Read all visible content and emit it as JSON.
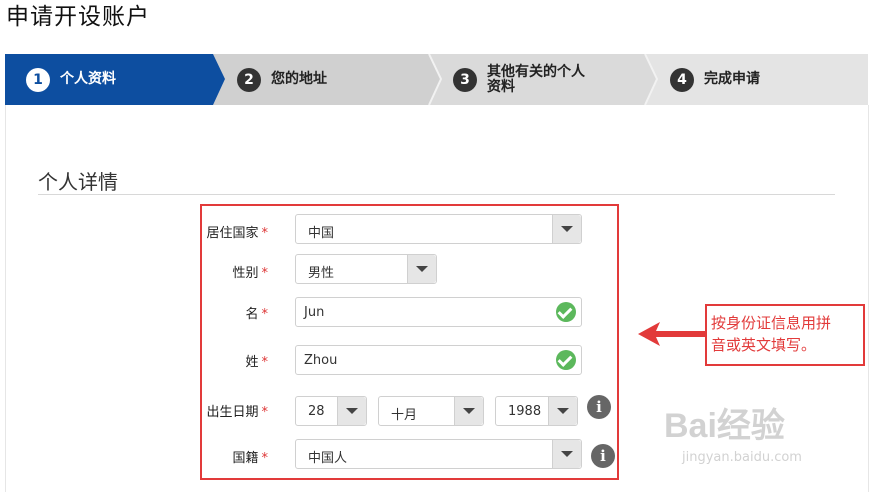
{
  "page": {
    "title": "申请开设账户"
  },
  "stepper": {
    "steps": [
      {
        "num": "1",
        "label": "个人资料",
        "state": "active"
      },
      {
        "num": "2",
        "label": "您的地址",
        "state": "inactive"
      },
      {
        "num": "3",
        "label": "其他有关的个人资料",
        "label_line1": "其他有关的个人",
        "label_line2": "资料",
        "state": "inactive"
      },
      {
        "num": "4",
        "label": "完成申请",
        "state": "inactive"
      }
    ],
    "colors": {
      "active": "#0d4ea0",
      "inactive": "#d4d4d4",
      "last": "#e4e4e4"
    }
  },
  "section": {
    "title": "个人详情"
  },
  "form": {
    "required_mark": "*",
    "country": {
      "label": "居住国家",
      "value": "中国"
    },
    "gender": {
      "label": "性别",
      "value": "男性"
    },
    "first_name": {
      "label": "名",
      "value": "Jun"
    },
    "last_name": {
      "label": "姓",
      "value": "Zhou"
    },
    "dob": {
      "label": "出生日期",
      "day": "28",
      "month": "十月",
      "year": "1988"
    },
    "nationality": {
      "label": "国籍",
      "value": "中国人"
    },
    "info_glyph": "i"
  },
  "annotation": {
    "line1": "按身份证信息用拼",
    "line2": "音或英文填写。",
    "color": "#e23a3a"
  },
  "watermark": {
    "main": "Bai经验",
    "sub": "jingyan.baidu.com"
  }
}
